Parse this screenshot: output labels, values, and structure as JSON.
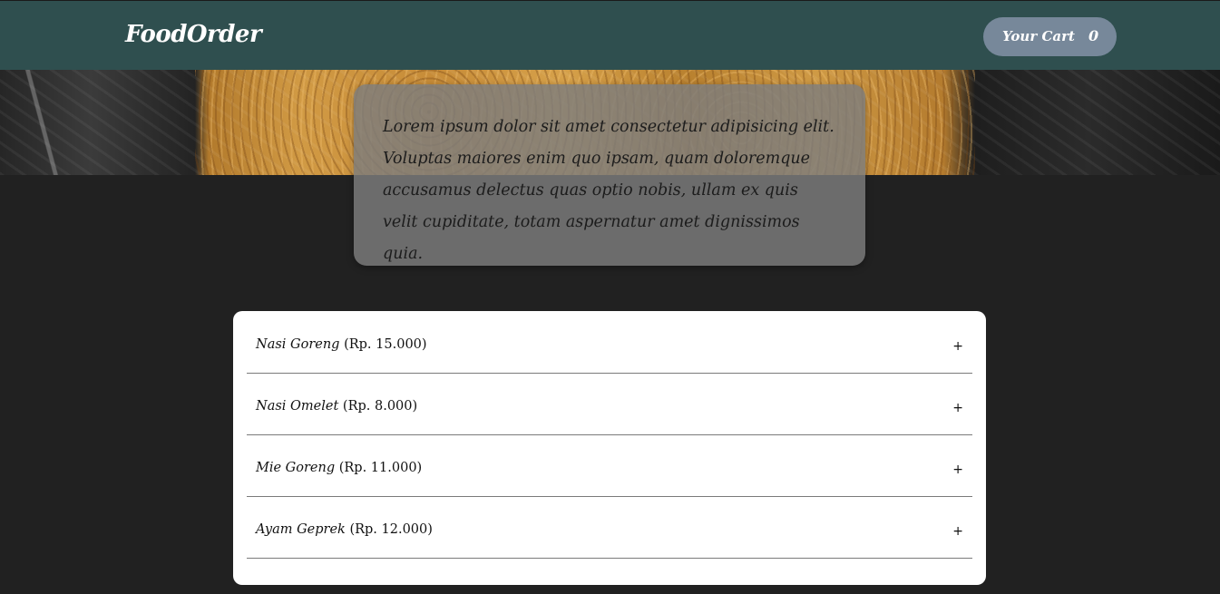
{
  "header": {
    "brand": "FoodOrder",
    "cart_label": "Your Cart",
    "cart_count": "0"
  },
  "summary": {
    "text": "Lorem ipsum dolor sit amet consectetur adipisicing elit. Voluptas maiores enim quo ipsam, quam doloremque accusamus delectus quas optio nobis, ullam ex quis velit cupiditate, totam aspernatur amet dignissimos quia."
  },
  "meals": [
    {
      "name": "Nasi Goreng",
      "price": "(Rp. 15.000)",
      "action": "+"
    },
    {
      "name": "Nasi Omelet",
      "price": "(Rp. 8.000)",
      "action": "+"
    },
    {
      "name": "Mie Goreng",
      "price": "(Rp. 11.000)",
      "action": "+"
    },
    {
      "name": "Ayam Geprek",
      "price": "(Rp. 12.000)",
      "action": "+"
    }
  ],
  "colors": {
    "header_bg": "#2f4f4f",
    "cart_button_bg": "#77889a",
    "page_bg": "#212121",
    "summary_bg": "#7d7d7d"
  }
}
